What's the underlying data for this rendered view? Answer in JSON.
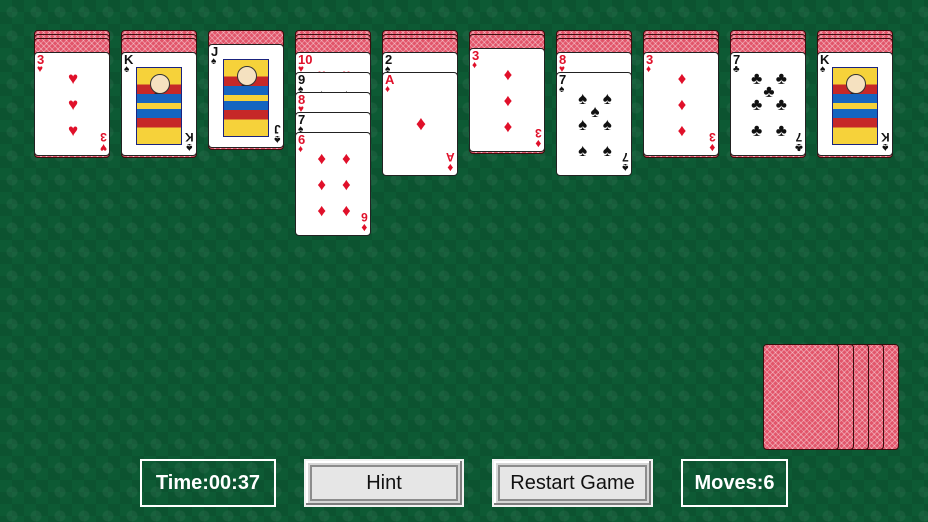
{
  "tableau": [
    {
      "down": 3,
      "up": [
        {
          "rank": "3",
          "suit": "hearts"
        }
      ]
    },
    {
      "down": 3,
      "up": [
        {
          "rank": "K",
          "suit": "spades"
        }
      ]
    },
    {
      "down": 1,
      "up": [
        {
          "rank": "J",
          "suit": "spades"
        }
      ]
    },
    {
      "down": 3,
      "up": [
        {
          "rank": "10",
          "suit": "hearts"
        },
        {
          "rank": "9",
          "suit": "spades"
        },
        {
          "rank": "8",
          "suit": "hearts"
        },
        {
          "rank": "7",
          "suit": "spades"
        },
        {
          "rank": "6",
          "suit": "diamonds"
        }
      ]
    },
    {
      "down": 3,
      "up": [
        {
          "rank": "2",
          "suit": "spades"
        },
        {
          "rank": "A",
          "suit": "diamonds"
        }
      ]
    },
    {
      "down": 2,
      "up": [
        {
          "rank": "3",
          "suit": "diamonds"
        }
      ]
    },
    {
      "down": 3,
      "up": [
        {
          "rank": "8",
          "suit": "hearts"
        },
        {
          "rank": "7",
          "suit": "spades"
        }
      ]
    },
    {
      "down": 3,
      "up": [
        {
          "rank": "3",
          "suit": "diamonds"
        }
      ]
    },
    {
      "down": 3,
      "up": [
        {
          "rank": "7",
          "suit": "clubs"
        }
      ]
    },
    {
      "down": 3,
      "up": [
        {
          "rank": "K",
          "suit": "spades"
        }
      ]
    }
  ],
  "stock": {
    "piles": 5
  },
  "status": {
    "time_label": "Time:",
    "time_value": "00:37",
    "moves_label": "Moves:",
    "moves_value": "6"
  },
  "buttons": {
    "hint": "Hint",
    "restart": "Restart Game"
  },
  "icons": {
    "hearts": "♥",
    "diamonds": "♦",
    "spades": "♠",
    "clubs": "♣"
  },
  "colors": {
    "felt": "#0d5a34",
    "card_red": "#e0102a",
    "card_black": "#111111",
    "card_back": "#e2556a"
  }
}
